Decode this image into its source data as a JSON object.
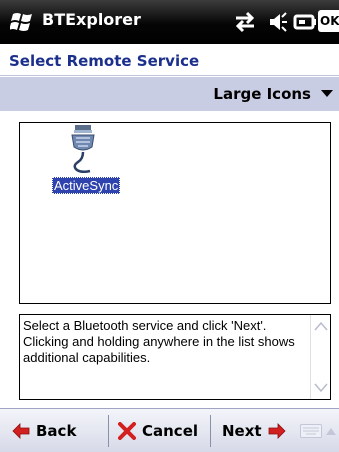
{
  "titlebar": {
    "app_title": "BTExplorer",
    "ok_label": "OK",
    "icons": [
      "windows-logo-icon",
      "connectivity-icon",
      "volume-icon",
      "battery-icon"
    ]
  },
  "header": {
    "title": "Select Remote Service"
  },
  "viewbar": {
    "view_mode": "Large Icons"
  },
  "service_list": {
    "items": [
      {
        "label": "ActiveSync",
        "icon": "activesync-cable-icon",
        "selected": true
      }
    ]
  },
  "hint": {
    "text": "Select a Bluetooth service and click 'Next'. Clicking and holding anywhere in the list shows additional capabilities."
  },
  "commandbar": {
    "back_label": "Back",
    "cancel_label": "Cancel",
    "next_label": "Next"
  },
  "colors": {
    "title_text": "#1b2f8c",
    "viewbar_bg": "#c9cde3",
    "selection_bg": "#2e43ae",
    "arrow_red": "#d21f1f"
  }
}
